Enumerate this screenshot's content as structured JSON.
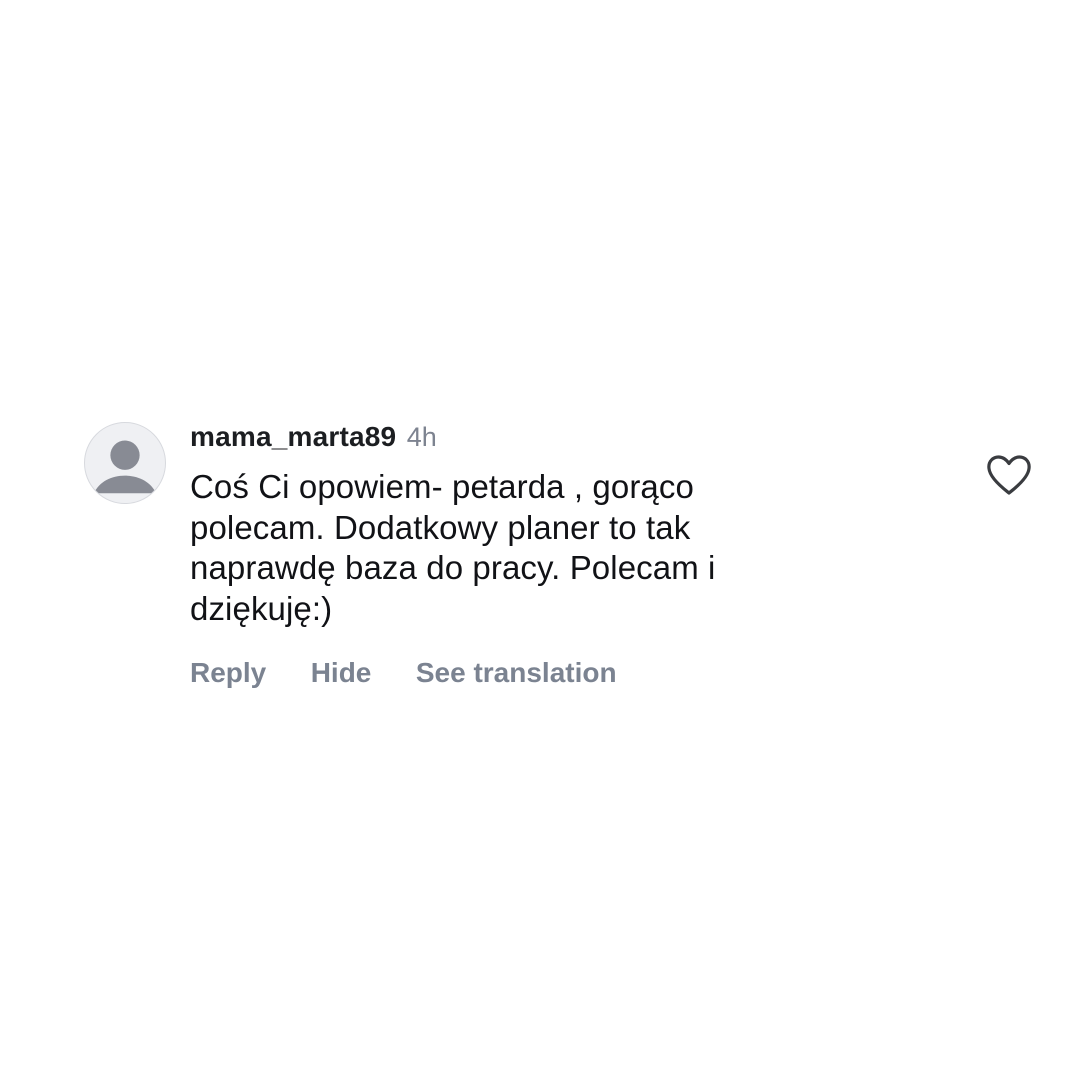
{
  "comment": {
    "username": "mama_marta89",
    "timestamp": "4h",
    "text_lines": [
      "Coś Ci opowiem- petarda , gorąco",
      "polecam. Dodatkowy planer to tak",
      "naprawdę baza do pracy. Polecam i",
      "dziękuję:)"
    ],
    "actions": {
      "reply": "Reply",
      "hide": "Hide",
      "see_translation": "See translation"
    },
    "avatar_icon": "default-profile-silhouette",
    "like_icon": "heart-outline-icon",
    "colors": {
      "username": "#1c1e21",
      "timestamp": "#7d8390",
      "text": "#111216",
      "actions": "#7b8391",
      "heart": "#3a3c40",
      "avatar_bg": "#eff0f3",
      "avatar_silhouette": "#888b94"
    }
  }
}
